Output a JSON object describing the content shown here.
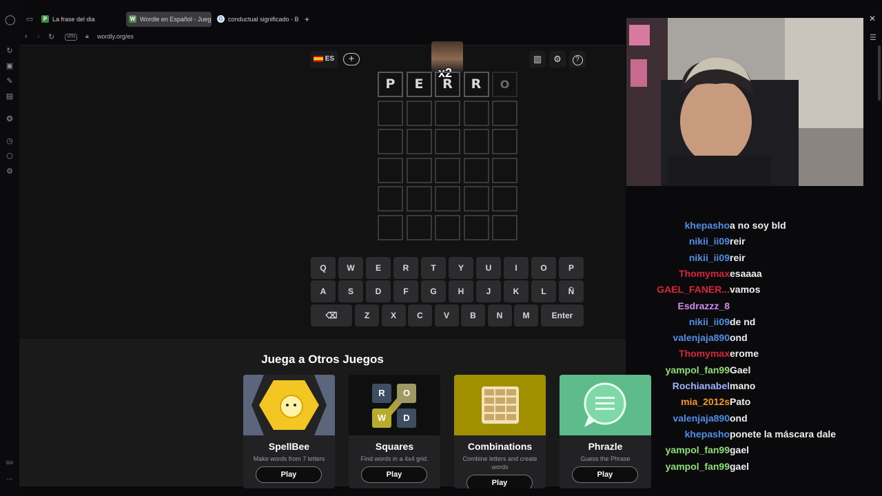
{
  "browser": {
    "tabs": [
      {
        "label": "La frase del dia",
        "favicon": "P",
        "favicon_color": "#3b8d3b"
      },
      {
        "label": "Wordle en Español - Jueg",
        "favicon": "W",
        "favicon_color": "#538d4e",
        "active": true
      },
      {
        "label": "conductual significado - B",
        "favicon": "G",
        "favicon_color": "#e8e8e8"
      }
    ],
    "new_tab": "+",
    "vpn": "VPN",
    "url": "wordly.org/es",
    "gx": "GX",
    "more": "..."
  },
  "wordle": {
    "language": "ES",
    "streamer_badge": "x2",
    "board": [
      [
        "P",
        "E",
        "R",
        "R",
        "O"
      ],
      [
        "",
        "",
        "",
        "",
        ""
      ],
      [
        "",
        "",
        "",
        "",
        ""
      ],
      [
        "",
        "",
        "",
        "",
        ""
      ],
      [
        "",
        "",
        "",
        "",
        ""
      ],
      [
        "",
        "",
        "",
        "",
        ""
      ]
    ],
    "keyboard": {
      "row1": [
        "Q",
        "W",
        "E",
        "R",
        "T",
        "Y",
        "U",
        "I",
        "O",
        "P"
      ],
      "row2": [
        "A",
        "S",
        "D",
        "F",
        "G",
        "H",
        "J",
        "K",
        "L",
        "Ñ"
      ],
      "row3": [
        "Z",
        "X",
        "C",
        "V",
        "B",
        "N",
        "M"
      ],
      "enter": "Enter",
      "backspace": "⌫"
    }
  },
  "other_games": {
    "title": "Juega a Otros Juegos",
    "cards": [
      {
        "name": "SpellBee",
        "desc": "Make words from 7 letters",
        "play": "Play",
        "color": "#4a5366"
      },
      {
        "name": "Squares",
        "desc": "Find words in a 4x4 grid.",
        "play": "Play",
        "color": "#0f0f10",
        "tiles": [
          "R",
          "O",
          "W",
          "D"
        ]
      },
      {
        "name": "Combinations",
        "desc": "Combine letters and create words",
        "play": "Play",
        "color": "#a09000"
      },
      {
        "name": "Phrazle",
        "desc": "Guess the Phrase",
        "play": "Play",
        "color": "#5dbb8c"
      }
    ]
  },
  "chat": [
    {
      "user": "khepasho",
      "msg": "a no soy bld",
      "color": "#4f8fe6"
    },
    {
      "user": "nikii_ii09",
      "msg": "reir",
      "color": "#4f8fe6"
    },
    {
      "user": "nikii_ii09",
      "msg": "reir",
      "color": "#4f8fe6"
    },
    {
      "user": "Thomymax",
      "msg": "esaaaa",
      "color": "#d7263d"
    },
    {
      "user": "GAEL_FANER...",
      "msg": "vamos",
      "color": "#d7263d"
    },
    {
      "user": "Esdrazzz_8",
      "msg": "",
      "color": "#d08cf0"
    },
    {
      "user": "nikii_ii09",
      "msg": "de nd",
      "color": "#4f8fe6"
    },
    {
      "user": "valenjaja890",
      "msg": "ond",
      "color": "#4f8fe6"
    },
    {
      "user": "Thomymax",
      "msg": "erome",
      "color": "#d7263d"
    },
    {
      "user": "yampol_fan99",
      "msg": "Gael",
      "color": "#8ee07a"
    },
    {
      "user": "Rochianabel",
      "msg": "mano",
      "color": "#9fb4ff"
    },
    {
      "user": "mia_2012s",
      "msg": "Pato",
      "color": "#f59a1b"
    },
    {
      "user": "valenjaja890",
      "msg": "ond",
      "color": "#4f8fe6"
    },
    {
      "user": "khepasho",
      "msg": "ponete la máscara dale",
      "color": "#4f8fe6"
    },
    {
      "user": "yampol_fan99",
      "msg": "gael",
      "color": "#8ee07a"
    },
    {
      "user": "yampol_fan99",
      "msg": "gael",
      "color": "#8ee07a"
    }
  ]
}
